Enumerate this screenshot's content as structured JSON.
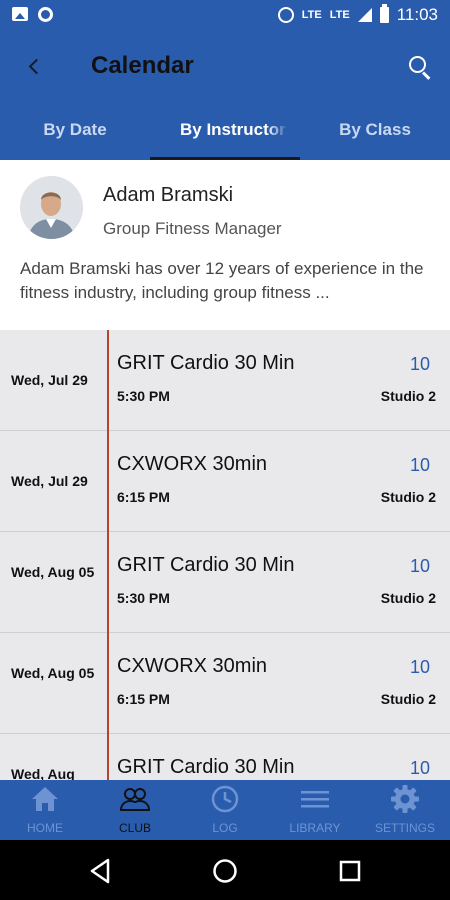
{
  "status_bar": {
    "lte_label_1": "LTE",
    "lte_label_2": "LTE",
    "time": "11:03"
  },
  "header": {
    "title": "Calendar"
  },
  "tabs": [
    {
      "label": "By Date",
      "active": false
    },
    {
      "label": "By Instructor",
      "active": true
    },
    {
      "label": "By Class",
      "active": false
    }
  ],
  "instructor": {
    "name": "Adam Bramski",
    "role": "Group Fitness Manager",
    "bio": "Adam Bramski has over 12 years of experience in the fitness industry, including group fitness ..."
  },
  "schedule": [
    {
      "date": "Wed, Jul 29",
      "class": "GRIT Cardio 30 Min",
      "time": "5:30 PM",
      "count": "10",
      "studio": "Studio 2"
    },
    {
      "date": "Wed, Jul 29",
      "class": "CXWORX 30min",
      "time": "6:15 PM",
      "count": "10",
      "studio": "Studio 2"
    },
    {
      "date": "Wed, Aug 05",
      "class": "GRIT Cardio 30 Min",
      "time": "5:30 PM",
      "count": "10",
      "studio": "Studio 2"
    },
    {
      "date": "Wed, Aug 05",
      "class": "CXWORX 30min",
      "time": "6:15 PM",
      "count": "10",
      "studio": "Studio 2"
    },
    {
      "date": "Wed, Aug",
      "class": "GRIT Cardio 30 Min",
      "time": "",
      "count": "10",
      "studio": ""
    }
  ],
  "bottom_nav": [
    {
      "label": "HOME",
      "icon": "home-icon",
      "active": false
    },
    {
      "label": "CLUB",
      "icon": "people-icon",
      "active": true
    },
    {
      "label": "LOG",
      "icon": "clock-icon",
      "active": false
    },
    {
      "label": "LIBRARY",
      "icon": "menu-lines-icon",
      "active": false
    },
    {
      "label": "SETTINGS",
      "icon": "gear-icon",
      "active": false
    }
  ],
  "colors": {
    "primary": "#2a5cae",
    "accent_line": "#b5452f",
    "nav_inactive": "#6e93d2"
  }
}
